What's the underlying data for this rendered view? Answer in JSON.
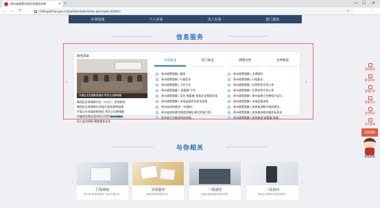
{
  "browser": {
    "tab_title": "贵州省政策问答信息服务系统",
    "url": "zwfw.guizhou.gov.cn/jsp/sbsxIndex/index.jsp?orgId=520527",
    "new_tab": "+",
    "min": "—",
    "max": "☐",
    "close": "✕",
    "back": "←",
    "forward": "→",
    "reload": "↻",
    "star": "☆",
    "menu": "⋮"
  },
  "top_nav": [
    "办事指南",
    "个人办事",
    "法人办事",
    "部门服务"
  ],
  "info_section": {
    "title": "信息服务",
    "left_arrow": "‹",
    "right_arrow": "›",
    "news": {
      "heading": "政务风采",
      "caption": "开展企业发展助推服务 帮扶企业解难题",
      "items": [
        "集团区区联镇联社办（5大片）深挖新招...",
        "集团区区联镇联社积极开展党建带团建...",
        "开展企业发展助推服务 帮扶企业解难题",
        "开展创业就业宣讲进万家推动乡村振兴...",
        "深入走访调研 精准服务企业"
      ]
    },
    "tabs": [
      "今日关注",
      "热门关注",
      "政策文件",
      "文件解读"
    ],
    "active_tab": 0,
    "list_left": [
      "贵州政策图解 | 要闻",
      "贵州政策图解 | 行政信访",
      "贵州政策图解 | 人防工作",
      "贵州政策图解 | \"放管服\"工作",
      "贵州政策图解 | 深化\"放管服\"改革优化营商环境",
      "贵州政策图解 | 市场监管综合执法改革...",
      "贵州省加快推进\"一网通办\"...",
      "贵州省加快建设制度保障区建设实施方案...",
      "贵州省大力推进科技创新..."
    ],
    "list_right": [
      "贵州政策图解 | 法律顾问",
      "贵州政策图解 | 行政复议",
      "贵州政策图解 | 扫黑除恶专项斗争",
      "贵州政策图解 | 扫黑除恶专项斗争",
      "贵州政策图解 | 贵州省建立完善权力运行...",
      "贵州政策图解 | 市场监管改革...",
      "贵州政策图解 | 加快推进数字政府建设...",
      "贵州政策图解 | 加快推进政务服务标准化...",
      "贵州政策图解 | 加快推进\"放管服\"改革..."
    ]
  },
  "related_section": {
    "title": "与你相关",
    "left_arrow": "‹",
    "right_arrow": "›",
    "cards": [
      {
        "name": "行政审批",
        "desc": "贵州省行政审批服务一站式办理平台..."
      },
      {
        "name": "法规服务",
        "desc": "法律法规查询服务平台..."
      },
      {
        "name": "一网通办",
        "desc": "汇聚全省各级政务服务事项..."
      },
      {
        "name": "一码贵州",
        "desc": "面向企业和群众的综合服务..."
      }
    ]
  },
  "sidebar": {
    "items": [
      "我的服务",
      "帮助导办",
      "智能问答",
      "我要评价",
      "咨询投诉",
      "办件查询"
    ],
    "top_label": "返回顶部",
    "mascot_label": "智能客服"
  },
  "colors": {
    "accent": "#2a78c2",
    "frame": "#e36b6b",
    "nav": "#2d4a6d",
    "side": "#d94a38"
  }
}
